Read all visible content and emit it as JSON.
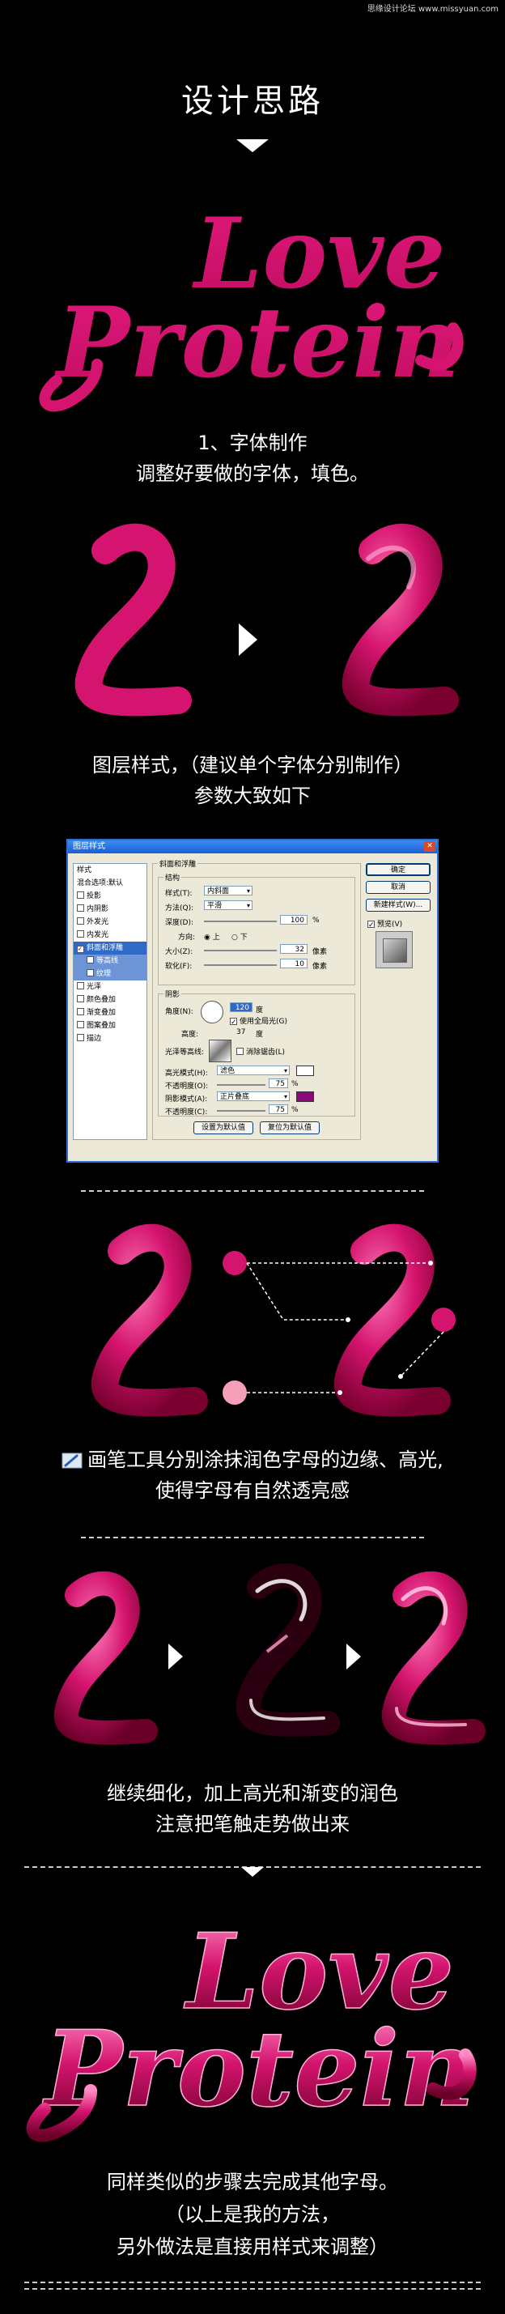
{
  "watermark": "思缘设计论坛 www.missyuan.com",
  "title": "设计思路",
  "section1": {
    "line1": "1、字体制作",
    "line2": "调整好要做的字体，填色。"
  },
  "section2": {
    "line1": "图层样式，（建议单个字体分别制作）",
    "line2": "参数大致如下"
  },
  "section3": {
    "line1": "画笔工具分别涂抹润色字母的边缘、高光,",
    "line2": "使得字母有自然透亮感"
  },
  "section4": {
    "line1": "继续细化，加上高光和渐变的润色",
    "line2": "注意把笔触走势做出来"
  },
  "section5": {
    "line1": "同样类似的步骤去完成其他字母。",
    "line2": "（以上是我的方法，",
    "line3": "另外做法是直接用样式来调整）"
  },
  "logo": {
    "word1": "Love",
    "word2": "Protein"
  },
  "letter": "L",
  "colors": {
    "magenta": "#d4146e",
    "shade": "#8a0034"
  },
  "dialog": {
    "title": "图层样式",
    "styles_header": "样式",
    "blend_default": "混合选项:默认",
    "items": [
      {
        "label": "投影",
        "checked": false
      },
      {
        "label": "内阴影",
        "checked": false
      },
      {
        "label": "外发光",
        "checked": false
      },
      {
        "label": "内发光",
        "checked": false
      },
      {
        "label": "斜面和浮雕",
        "checked": true,
        "selected": true
      },
      {
        "label": "等高线",
        "checked": false,
        "sub": true
      },
      {
        "label": "纹理",
        "checked": false,
        "sub": true
      },
      {
        "label": "光泽",
        "checked": false
      },
      {
        "label": "颜色叠加",
        "checked": false
      },
      {
        "label": "渐变叠加",
        "checked": false
      },
      {
        "label": "图案叠加",
        "checked": false
      },
      {
        "label": "描边",
        "checked": false
      }
    ],
    "bevel_title": "斜面和浮雕",
    "structure_title": "结构",
    "style_label": "样式(T):",
    "style_value": "内斜面",
    "technique_label": "方法(Q):",
    "technique_value": "平滑",
    "depth_label": "深度(D):",
    "depth_value": "100",
    "depth_unit": "%",
    "direction_label": "方向:",
    "dir_up": "上",
    "dir_down": "下",
    "size_label": "大小(Z):",
    "size_value": "32",
    "size_unit": "像素",
    "soften_label": "软化(F):",
    "soften_value": "10",
    "soften_unit": "像素",
    "shading_title": "阴影",
    "angle_label": "角度(N):",
    "angle_value": "120",
    "angle_unit": "度",
    "global_light": "使用全局光(G)",
    "altitude_label": "高度:",
    "altitude_value": "37",
    "altitude_unit": "度",
    "gloss_label": "光泽等高线:",
    "antialias": "消除锯齿(L)",
    "highlight_label": "高光模式(H):",
    "highlight_value": "滤色",
    "opacity1_label": "不透明度(O):",
    "opacity1_value": "75",
    "opacity_unit": "%",
    "shadow_label": "阴影模式(A):",
    "shadow_value": "正片叠底",
    "opacity2_label": "不透明度(C):",
    "opacity2_value": "75",
    "btn_default": "设置为默认值",
    "btn_reset": "复位为默认值",
    "btn_ok": "确定",
    "btn_cancel": "取消",
    "btn_new": "新建样式(W)...",
    "preview_label": "预览(V)",
    "highlight_color": "#ffffff",
    "shadow_color": "#8b0a7a"
  }
}
